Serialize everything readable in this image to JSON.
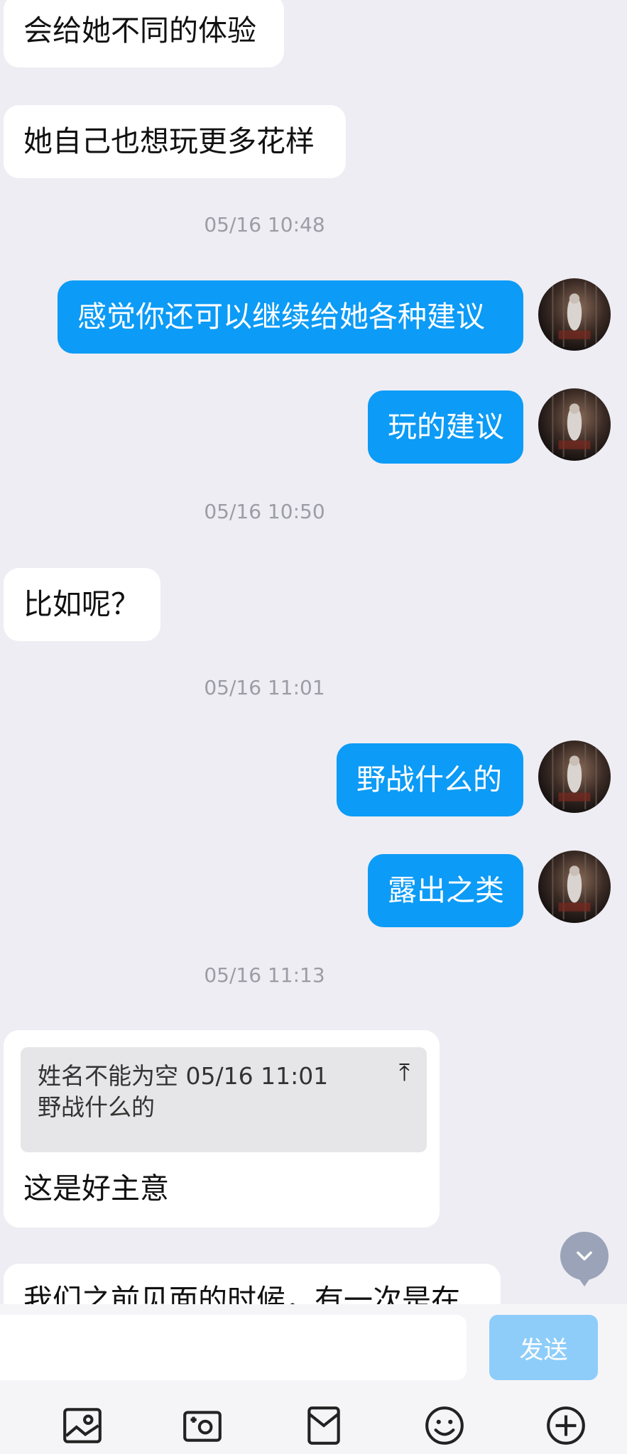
{
  "messages": {
    "m1": "会给她不同的体验",
    "m2": "她自己也想玩更多花样",
    "t1": "05/16 10:48",
    "m3": "感觉你还可以继续给她各种建议",
    "m4": "玩的建议",
    "t2": "05/16 10:50",
    "m5": "比如呢？",
    "t3": "05/16 11:01",
    "m6": "野战什么的",
    "m7": "露出之类",
    "t4": "05/16 11:13",
    "quote_meta": "姓名不能为空 05/16 11:01",
    "quote_text": "野战什么的",
    "reply": "这是好主意",
    "cut_off": "我们之前见面的时候，有一次是在"
  },
  "input": {
    "placeholder": "",
    "send_label": "发送"
  },
  "toolbar": {
    "icons": [
      "photo-icon",
      "camera-icon",
      "envelope-icon",
      "emoji-icon",
      "plus-icon"
    ]
  },
  "colors": {
    "outgoing_bubble": "#0c9bf6",
    "incoming_bubble": "#ffffff",
    "background": "#eeedf3",
    "send_disabled": "#8ecdfa"
  }
}
